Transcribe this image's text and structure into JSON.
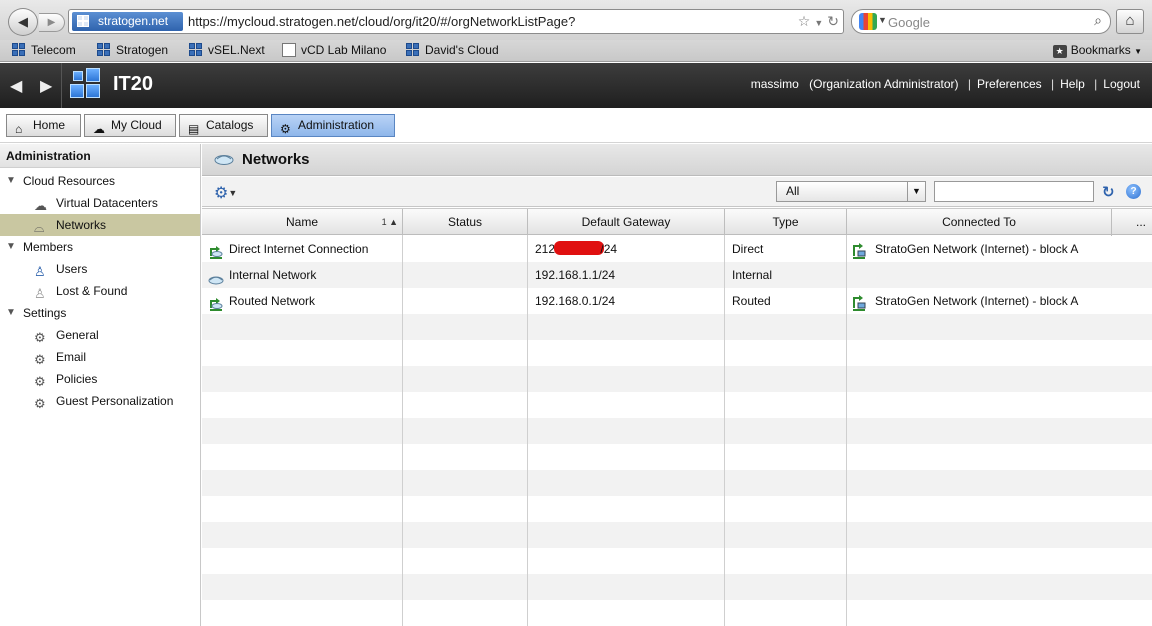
{
  "browser": {
    "site_identity": "stratogen.net",
    "url": "https://mycloud.stratogen.net/cloud/org/it20/#/orgNetworkListPage?",
    "search_placeholder": "Google",
    "bookmarks": [
      {
        "label": "Telecom",
        "icon": "cube-icon"
      },
      {
        "label": "Stratogen",
        "icon": "cube-icon"
      },
      {
        "label": "vSEL.Next",
        "icon": "cube-icon"
      },
      {
        "label": "vCD Lab Milano",
        "icon": "page-icon"
      },
      {
        "label": "David's Cloud",
        "icon": "cube-icon"
      }
    ],
    "bookmarks_menu": "Bookmarks"
  },
  "app": {
    "title": "IT20",
    "user": "massimo",
    "role": "(Organization Administrator)",
    "links": {
      "preferences": "Preferences",
      "help": "Help",
      "logout": "Logout"
    },
    "separator": "|"
  },
  "tabs": [
    {
      "label": "Home",
      "icon": "home-icon"
    },
    {
      "label": "My Cloud",
      "icon": "cloud-icon"
    },
    {
      "label": "Catalogs",
      "icon": "catalog-icon"
    },
    {
      "label": "Administration",
      "icon": "admin-icon",
      "active": true
    }
  ],
  "sidebar": {
    "title": "Administration",
    "groups": [
      {
        "label": "Cloud Resources",
        "items": [
          {
            "label": "Virtual Datacenters",
            "icon": "datacenter-icon"
          },
          {
            "label": "Networks",
            "icon": "network-icon",
            "selected": true
          }
        ]
      },
      {
        "label": "Members",
        "items": [
          {
            "label": "Users",
            "icon": "user-icon"
          },
          {
            "label": "Lost & Found",
            "icon": "lost-found-icon"
          }
        ]
      },
      {
        "label": "Settings",
        "items": [
          {
            "label": "General",
            "icon": "gear-icon"
          },
          {
            "label": "Email",
            "icon": "gear-icon"
          },
          {
            "label": "Policies",
            "icon": "gear-icon"
          },
          {
            "label": "Guest Personalization",
            "icon": "gear-icon"
          }
        ]
      }
    ]
  },
  "content": {
    "title": "Networks",
    "filter": {
      "selected": "All",
      "search_value": ""
    },
    "columns": [
      "Name",
      "Status",
      "Default Gateway",
      "Type",
      "Connected To",
      "..."
    ],
    "sort_indicator": "1 ▲",
    "rows": [
      {
        "name": "Direct Internet Connection",
        "status": "",
        "gateway_prefix": "212.",
        "gateway_suffix": "/24",
        "gateway_redacted": true,
        "type": "Direct",
        "connected_to": "StratoGen Network (Internet) - block A"
      },
      {
        "name": "Internal Network",
        "status": "",
        "gateway_prefix": "192.168.1.1/24",
        "gateway_suffix": "",
        "gateway_redacted": false,
        "type": "Internal",
        "connected_to": ""
      },
      {
        "name": "Routed Network",
        "status": "",
        "gateway_prefix": "192.168.0.1/24",
        "gateway_suffix": "",
        "gateway_redacted": false,
        "type": "Routed",
        "connected_to": "StratoGen Network (Internet) - block A"
      }
    ]
  },
  "colors": {
    "active_tab": "#9fc2ef",
    "selected_sidebar": "#c9c7a1",
    "redaction": "#e01010",
    "header_bg": "#2a2a2a"
  }
}
